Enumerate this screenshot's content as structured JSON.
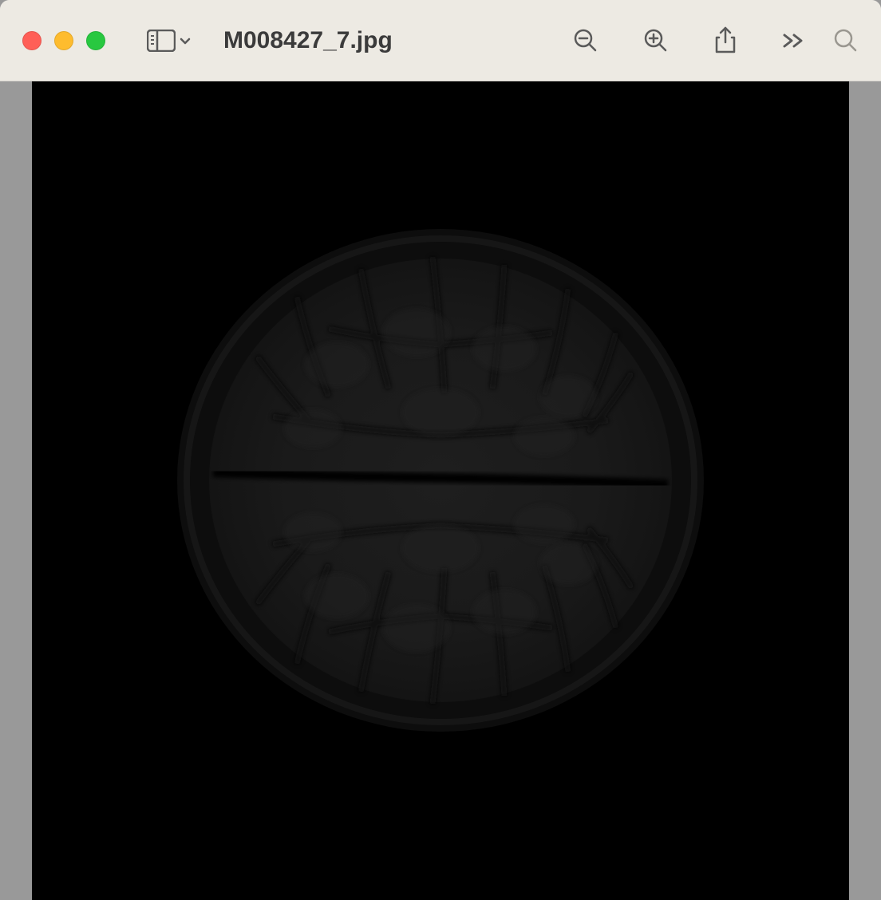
{
  "window": {
    "title": "M008427_7.jpg"
  },
  "toolbar": {
    "sidebar_toggle": "sidebar-icon",
    "zoom_out": "zoom-out-icon",
    "zoom_in": "zoom-in-icon",
    "share": "share-icon",
    "more": "more-icon",
    "search": "search-icon"
  },
  "traffic_lights": {
    "close": "close",
    "minimize": "minimize",
    "maximize": "maximize"
  }
}
